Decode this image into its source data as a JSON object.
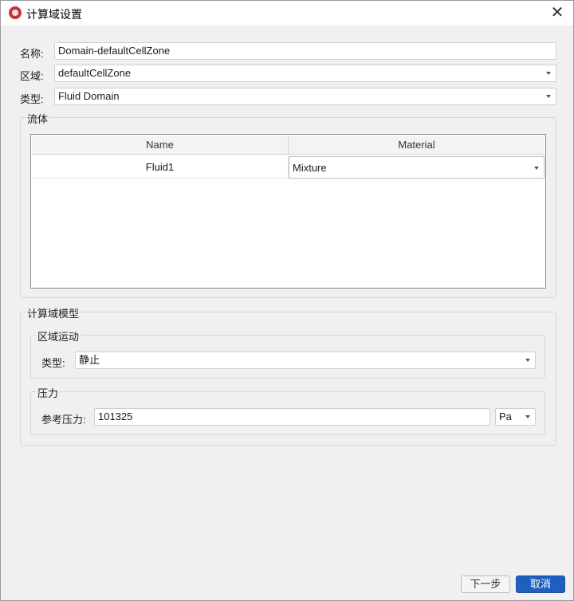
{
  "window": {
    "title": "计算域设置"
  },
  "form": {
    "name_label": "名称:",
    "name_value": "Domain-defaultCellZone",
    "region_label": "区域:",
    "region_value": "defaultCellZone",
    "type_label": "类型:",
    "type_value": "Fluid Domain"
  },
  "fluid": {
    "group_title": "流体",
    "columns": [
      "Name",
      "Material"
    ],
    "rows": [
      {
        "name": "Fluid1",
        "material": "Mixture"
      }
    ]
  },
  "model": {
    "group_title": "计算域模型",
    "motion": {
      "group_title": "区域运动",
      "type_label": "类型:",
      "type_value": "静止"
    },
    "pressure": {
      "group_title": "压力",
      "ref_label": "参考压力:",
      "ref_value": "101325",
      "unit_value": "Pa"
    }
  },
  "buttons": {
    "next": "下一步",
    "cancel": "取消"
  },
  "colors": {
    "primary_button": "#1f5fbf",
    "app_icon": "#c8323a"
  }
}
